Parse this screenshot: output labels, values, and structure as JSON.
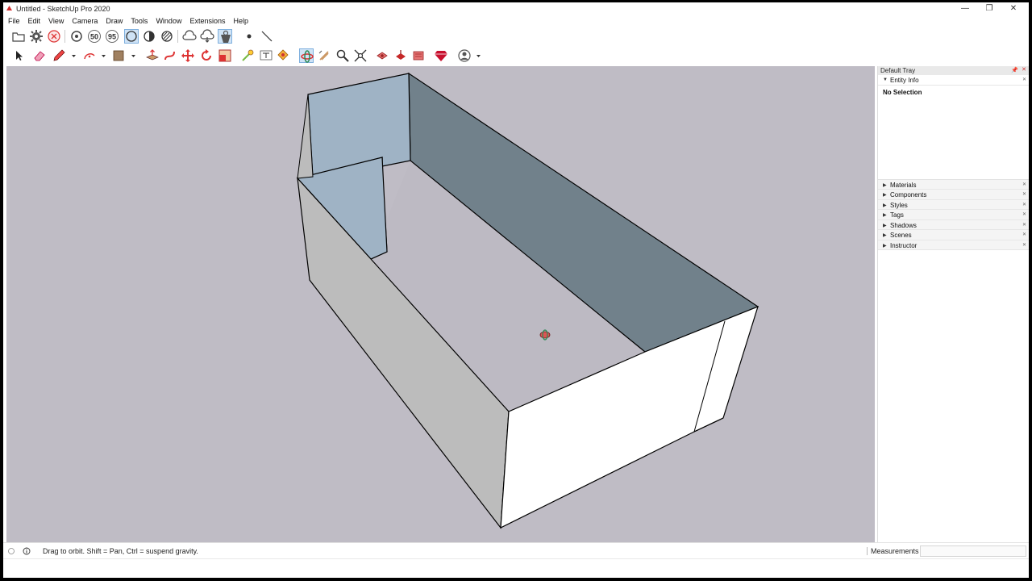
{
  "window": {
    "title": "Untitled - SketchUp Pro 2020",
    "minimize": "—",
    "restore": "❐",
    "close": "✕"
  },
  "menu": [
    "File",
    "Edit",
    "View",
    "Camera",
    "Draw",
    "Tools",
    "Window",
    "Extensions",
    "Help"
  ],
  "toolbar1": {
    "tools": [
      "open-icon",
      "settings-icon",
      "stop-icon",
      "orbit-pan-icon",
      "fifty-icon",
      "ninety-five-icon",
      "circle-icon",
      "half-circle-icon",
      "hatched-circle-icon",
      "cloud-upload-icon",
      "cloud-download-icon",
      "warehouse-icon",
      "dot-icon",
      "line-icon"
    ],
    "labels": {
      "fifty": "50",
      "ninety_five": "95"
    }
  },
  "toolbar2": {
    "tools": [
      "select-icon",
      "eraser-icon",
      "pencil-icon",
      "arc-icon",
      "rectangle-icon",
      "push-pull-icon",
      "follow-me-icon",
      "move-icon",
      "rotate-icon",
      "scale-icon",
      "tape-measure-icon",
      "text-icon",
      "paint-bucket-icon",
      "orbit-icon",
      "walk-icon",
      "zoom-icon",
      "zoom-extents-icon",
      "section-icon",
      "section-fill-icon",
      "section-display-icon",
      "ruby-icon",
      "profile-icon"
    ],
    "active": "orbit-icon"
  },
  "tray": {
    "title": "Default Tray",
    "entity_info": {
      "label": "Entity Info",
      "selection": "No Selection"
    },
    "panels": [
      "Materials",
      "Components",
      "Styles",
      "Tags",
      "Shadows",
      "Scenes",
      "Instructor"
    ]
  },
  "status": {
    "hint": "Drag to orbit. Shift = Pan, Ctrl = suspend gravity.",
    "measurements_label": "Measurements",
    "measurements_value": ""
  },
  "colors": {
    "sky": "#bfbcc5",
    "wall_blue": "#9fb3c5",
    "wall_dark": "#71818b",
    "wall_light": "#bcbcbc",
    "wall_white": "#ffffff",
    "ruby_red": "#c8102e",
    "orbit_green": "#2e8b57"
  }
}
